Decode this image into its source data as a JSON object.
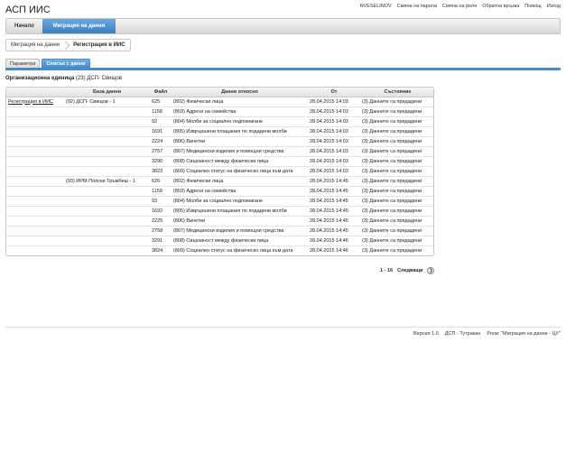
{
  "app": {
    "title": "АСП ИИС"
  },
  "top_links": [
    "NVESELINOV",
    "Смяна на парола",
    "Смяна на роля",
    "Обратна връзка",
    "Помощ",
    "Изход"
  ],
  "menu": {
    "home": "Начало",
    "migration": "Миграция на данни"
  },
  "breadcrumb": {
    "parent": "Миграция на данни",
    "current": "Регистрация в ИИС"
  },
  "tabs": {
    "params": "Параметри",
    "list": "Списък с данни"
  },
  "org": {
    "label": "Организационна единица",
    "value": "(23) ДСП- Свищов"
  },
  "table": {
    "headers": [
      "База данни",
      "Файл",
      "Данни относно",
      "От",
      "Състояние"
    ],
    "rows": [
      {
        "reg": "Регистрация в ИИС",
        "db": "(92) ДСП- Свищов - 1",
        "file": "625",
        "about": "(802) Физически лица",
        "from": "28.04.2015 14:03",
        "state": "(3) Данните са предадени"
      },
      {
        "reg": "",
        "db": "",
        "file": "1158",
        "about": "(803) Адреси на семейства",
        "from": "28.04.2015 14:03",
        "state": "(3) Данните са предадени"
      },
      {
        "reg": "",
        "db": "",
        "file": "92",
        "about": "(804) Молби за социално подпомагане",
        "from": "28.04.2015 14:03",
        "state": "(3) Данните са предадени"
      },
      {
        "reg": "",
        "db": "",
        "file": "1691",
        "about": "(805) Изврършени плащания по подадени молби",
        "from": "28.04.2015 14:03",
        "state": "(3) Данните са предадени"
      },
      {
        "reg": "",
        "db": "",
        "file": "2224",
        "about": "(806) Винетки",
        "from": "28.04.2015 14:03",
        "state": "(3) Данните са предадени"
      },
      {
        "reg": "",
        "db": "",
        "file": "2757",
        "about": "(807) Медицински изделия и помощни средства",
        "from": "28.04.2015 14:03",
        "state": "(3) Данните са предадени"
      },
      {
        "reg": "",
        "db": "",
        "file": "3290",
        "about": "(808) Свързаност между физически лица",
        "from": "28.04.2015 14:03",
        "state": "(3) Данните са предадени"
      },
      {
        "reg": "",
        "db": "",
        "file": "3823",
        "about": "(809) Социален статус на физическо лица към дата",
        "from": "28.04.2015 14:03",
        "state": "(3) Данните са предадени"
      },
      {
        "reg": "",
        "db": "(93) ИРМ-Полски Тръмбеш - 1",
        "file": "626",
        "about": "(802) Физически лица",
        "from": "28.04.2015 14:45",
        "state": "(3) Данните са предадени"
      },
      {
        "reg": "",
        "db": "",
        "file": "1159",
        "about": "(803) Адреси на семейства",
        "from": "28.04.2015 14:45",
        "state": "(3) Данните са предадени"
      },
      {
        "reg": "",
        "db": "",
        "file": "93",
        "about": "(804) Молби за социално подпомагане",
        "from": "28.04.2015 14:45",
        "state": "(3) Данните са предадени"
      },
      {
        "reg": "",
        "db": "",
        "file": "1692",
        "about": "(805) Изврършени плащания по подадени молби",
        "from": "28.04.2015 14:45",
        "state": "(3) Данните са предадени"
      },
      {
        "reg": "",
        "db": "",
        "file": "2225",
        "about": "(806) Винетки",
        "from": "28.04.2015 14:45",
        "state": "(3) Данните са предадени"
      },
      {
        "reg": "",
        "db": "",
        "file": "2758",
        "about": "(807) Медицински изделия и помощни средства",
        "from": "28.04.2015 14:45",
        "state": "(3) Данните са предадени"
      },
      {
        "reg": "",
        "db": "",
        "file": "3291",
        "about": "(808) Свързаност между физически лица",
        "from": "28.04.2015 14:46",
        "state": "(3) Данните са предадени"
      },
      {
        "reg": "",
        "db": "",
        "file": "3824",
        "about": "(809) Социален статус на физическо лица към дата",
        "from": "28.04.2015 14:46",
        "state": "(3) Данните са предадени"
      }
    ]
  },
  "pager": {
    "range": "1 - 16",
    "next": "Следващи",
    "next_icon": "chevron-right-icon"
  },
  "footer": {
    "version": "Версия 1.0",
    "unit": "ДСП - Тутракан",
    "roles": "Роли: \"Миграция на данни - ЦУ\""
  },
  "colors": {
    "accent": "#4b8ac8",
    "menu_active": "#3c7fc0"
  }
}
